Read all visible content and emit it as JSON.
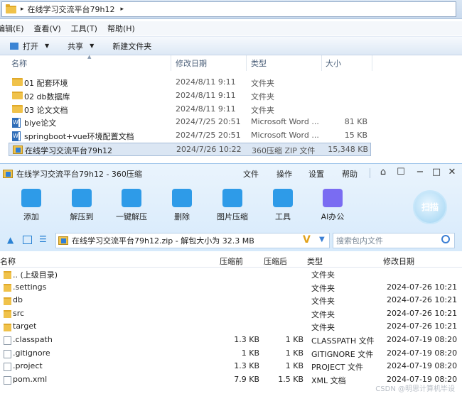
{
  "explorer": {
    "breadcrumb": [
      "在线学习交流平台79h12"
    ],
    "menu": [
      "编辑(E)",
      "查看(V)",
      "工具(T)",
      "帮助(H)"
    ],
    "toolbar": {
      "open": "打开",
      "share": "共享",
      "new_folder": "新建文件夹"
    },
    "columns": {
      "name": "名称",
      "modified": "修改日期",
      "type": "类型",
      "size": "大小"
    },
    "files": [
      {
        "name": "01 配套环境",
        "modified": "2024/8/11 9:11",
        "type": "文件夹",
        "size": "",
        "icon": "folder-icon"
      },
      {
        "name": "02 db数据库",
        "modified": "2024/8/11 9:11",
        "type": "文件夹",
        "size": "",
        "icon": "folder-icon"
      },
      {
        "name": "03 论文文档",
        "modified": "2024/8/11 9:11",
        "type": "文件夹",
        "size": "",
        "icon": "folder-icon"
      },
      {
        "name": "biye论文",
        "modified": "2024/7/25 20:51",
        "type": "Microsoft Word ...",
        "size": "81 KB",
        "icon": "word-doc-icon"
      },
      {
        "name": "springboot+vue环境配置文档",
        "modified": "2024/7/25 20:51",
        "type": "Microsoft Word ...",
        "size": "15 KB",
        "icon": "word-doc-icon"
      },
      {
        "name": "在线学习交流平台79h12",
        "modified": "2024/7/26 10:22",
        "type": "360压缩 ZIP 文件",
        "size": "15,348 KB",
        "icon": "zip-icon",
        "selected": true
      }
    ]
  },
  "zip": {
    "title": "在线学习交流平台79h12 - 360压缩",
    "menu": [
      "文件",
      "操作",
      "设置",
      "帮助"
    ],
    "tools": [
      {
        "label": "添加",
        "icon": "add-icon",
        "color": "#2e9be8"
      },
      {
        "label": "解压到",
        "icon": "extract-to-icon",
        "color": "#2e9be8"
      },
      {
        "label": "一键解压",
        "icon": "one-click-extract-icon",
        "color": "#2e9be8"
      },
      {
        "label": "删除",
        "icon": "delete-icon",
        "color": "#2e9be8"
      },
      {
        "label": "图片压缩",
        "icon": "image-compress-icon",
        "color": "#2e9be8"
      },
      {
        "label": "工具",
        "icon": "tools-icon",
        "color": "#2e9be8"
      },
      {
        "label": "AI办公",
        "icon": "ai-office-icon",
        "color": "#7a6cf2"
      }
    ],
    "scan_label": "扫描",
    "path": "在线学习交流平台79h12.zip - 解包大小为 32.3 MB",
    "search_placeholder": "搜索包内文件",
    "columns": {
      "name": "名称",
      "compressed": "压缩前",
      "packed": "压缩后",
      "type": "类型",
      "modified": "修改日期"
    },
    "entries": [
      {
        "name": ".. (上级目录)",
        "compressed": "",
        "packed": "",
        "type": "文件夹",
        "modified": ""
      },
      {
        "name": ".settings",
        "compressed": "",
        "packed": "",
        "type": "文件夹",
        "modified": "2024-07-26 10:21"
      },
      {
        "name": "db",
        "compressed": "",
        "packed": "",
        "type": "文件夹",
        "modified": "2024-07-26 10:21"
      },
      {
        "name": "src",
        "compressed": "",
        "packed": "",
        "type": "文件夹",
        "modified": "2024-07-26 10:21"
      },
      {
        "name": "target",
        "compressed": "",
        "packed": "",
        "type": "文件夹",
        "modified": "2024-07-26 10:21"
      },
      {
        "name": ".classpath",
        "compressed": "1.3 KB",
        "packed": "1 KB",
        "type": "CLASSPATH 文件",
        "modified": "2024-07-19 08:20"
      },
      {
        "name": ".gitignore",
        "compressed": "1 KB",
        "packed": "1 KB",
        "type": "GITIGNORE 文件",
        "modified": "2024-07-19 08:20"
      },
      {
        "name": ".project",
        "compressed": "1.3 KB",
        "packed": "1 KB",
        "type": "PROJECT 文件",
        "modified": "2024-07-19 08:20"
      },
      {
        "name": "pom.xml",
        "compressed": "7.9 KB",
        "packed": "1.5 KB",
        "type": "XML 文档",
        "modified": "2024-07-19 08:20"
      }
    ],
    "watermark": "CSDN @明思计算机毕设"
  }
}
